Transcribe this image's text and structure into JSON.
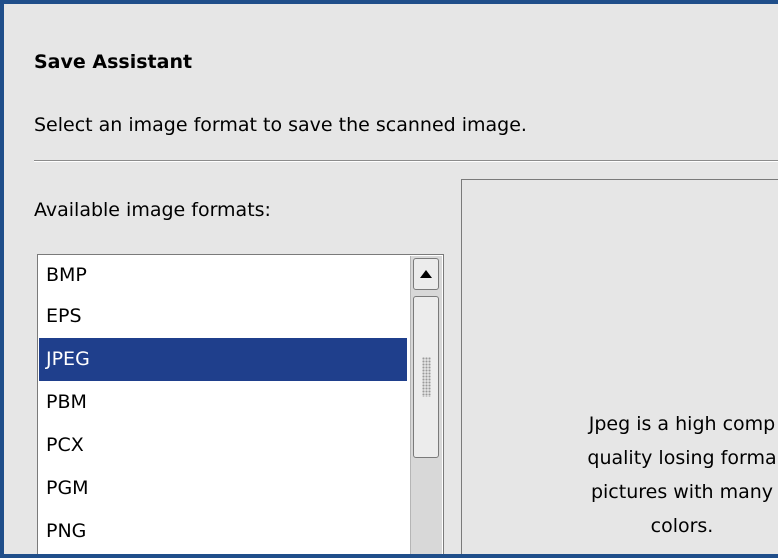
{
  "dialog": {
    "title": "Save Assistant",
    "description": "Select an image format to save the scanned image."
  },
  "format_list": {
    "label": "Available image formats:",
    "items": [
      "BMP",
      "EPS",
      "JPEG",
      "PBM",
      "PCX",
      "PGM",
      "PNG"
    ],
    "selected": "JPEG"
  },
  "preview": {
    "lines": [
      "Jpeg is a high comp",
      "quality losing forma",
      "pictures with many",
      "colors."
    ]
  },
  "colors": {
    "selection": "#1f3f8c",
    "frame": "#1f4e8a",
    "background": "#e6e6e6"
  },
  "icons": {
    "scroll_up": "triangle-up-icon",
    "scroll_grip": "grip-dots-icon"
  }
}
